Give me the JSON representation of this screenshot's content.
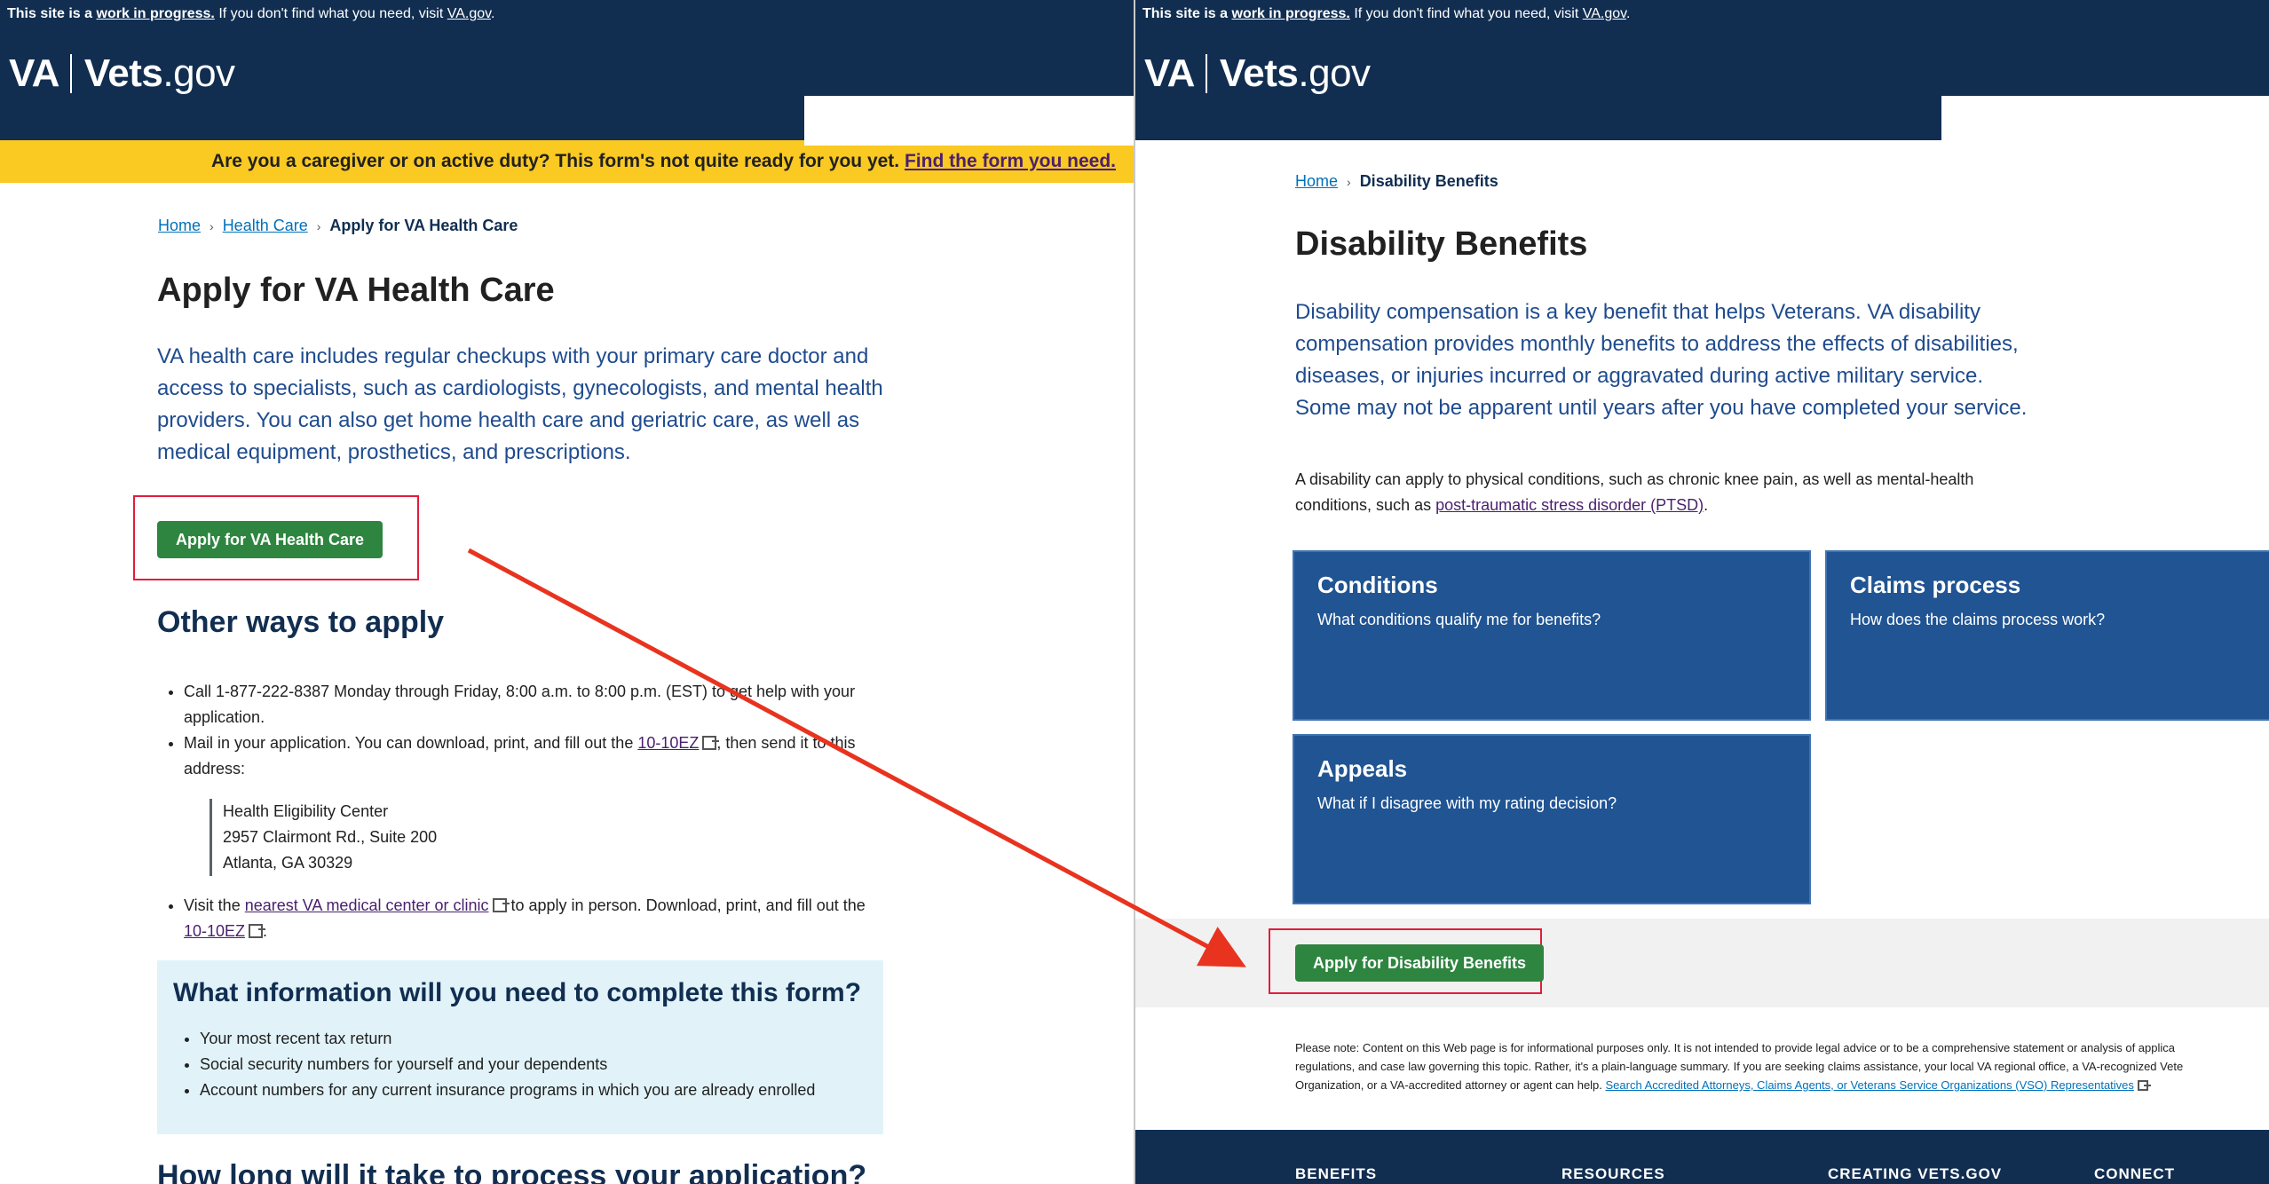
{
  "notice": {
    "prefix": "This site is a",
    "link": "work in progress.",
    "suffix": " If you don't find what you need, visit",
    "va_link": "VA.gov",
    "end": "."
  },
  "logo": {
    "va": "VA",
    "vets": "Vets",
    "gov": ".gov"
  },
  "left": {
    "alert": {
      "text": "Are you a caregiver or on active duty? This form's not quite ready for you yet.",
      "link": "Find the form you need."
    },
    "breadcrumb": [
      "Home",
      "Health Care",
      "Apply for VA Health Care"
    ],
    "title": "Apply for VA Health Care",
    "lead": "VA health care includes regular checkups with your primary care doctor and access to specialists, such as cardiologists, gynecologists, and mental health providers. You can also get home health care and geriatric care, as well as medical equipment, prosthetics, and prescriptions.",
    "apply_button": "Apply for VA Health Care",
    "other_heading": "Other ways to apply",
    "call_item": "Call 1-877-222-8387 Monday through Friday, 8:00 a.m. to 8:00 p.m. (EST) to get help with your application.",
    "mail_item": {
      "before": "Mail in your application. You can download, print, and fill out the ",
      "link": "10-10EZ",
      "after": ", then send it to this address:"
    },
    "address": [
      "Health Eligibility Center",
      "2957 Clairmont Rd., Suite 200",
      "Atlanta, GA 30329"
    ],
    "visit_item": {
      "before": "Visit the ",
      "link": "nearest VA medical center or clinic",
      "after": " to apply in person. Download, print, and fill out the",
      "link2": "10-10EZ",
      "end": "."
    },
    "info_heading": "What information will you need to complete this form?",
    "info_items": [
      "Your most recent tax return",
      "Social security numbers for yourself and your dependents",
      "Account numbers for any current insurance programs in which you are already enrolled"
    ],
    "next_heading": "How long will it take to process your application?"
  },
  "right": {
    "breadcrumb": [
      "Home",
      "Disability Benefits"
    ],
    "title": "Disability Benefits",
    "lead": "Disability compensation is a key benefit that helps Veterans. VA disability compensation provides monthly benefits to address the effects of disabilities, diseases, or injuries incurred or aggravated during active military service. Some may not be apparent until years after you have completed your service.",
    "body_before": "A disability can apply to physical conditions, such as chronic knee pain, as well as mental-health conditions, such as ",
    "body_link": "post-traumatic stress disorder (PTSD)",
    "body_end": ".",
    "tiles": [
      {
        "title": "Conditions",
        "sub": "What conditions qualify me for benefits?"
      },
      {
        "title": "Claims process",
        "sub": "How does the claims process work?"
      },
      {
        "title": "Appeals",
        "sub": "What if I disagree with my rating decision?"
      }
    ],
    "apply_button": "Apply for Disability Benefits",
    "note_lines": [
      "Please note: Content on this Web page is for informational purposes only. It is not intended to provide legal advice or to be a comprehensive statement or analysis of applica",
      "regulations, and case law governing this topic. Rather, it's a plain-language summary. If you are seeking claims assistance, your local VA regional office, a VA-recognized Vete",
      "Organization, or a VA-accredited attorney or agent can help. "
    ],
    "note_link": "Search Accredited Attorneys, Claims Agents, or Veterans Service Organizations (VSO) Representatives",
    "footer": [
      "BENEFITS",
      "RESOURCES",
      "CREATING VETS.GOV",
      "CONNECT"
    ]
  },
  "colors": {
    "navy": "#112e51",
    "alert_yellow": "#fac922",
    "green_button": "#2e8540",
    "tile_blue": "#205493",
    "annotation_red": "#e8331f"
  }
}
